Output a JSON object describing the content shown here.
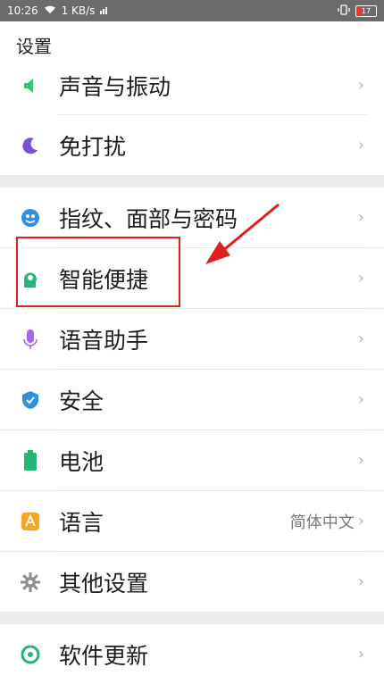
{
  "statusbar": {
    "time": "10:26",
    "speed": "1 KB/s",
    "battery": "17"
  },
  "header": {
    "title": "设置"
  },
  "items": [
    {
      "label": "声音与振动",
      "icon": "speaker-icon"
    },
    {
      "label": "免打扰",
      "icon": "moon-icon"
    },
    {
      "label": "指纹、面部与密码",
      "icon": "fingerprint-face-icon"
    },
    {
      "label": "智能便捷",
      "icon": "smart-head-icon"
    },
    {
      "label": "语音助手",
      "icon": "microphone-icon"
    },
    {
      "label": "安全",
      "icon": "shield-icon"
    },
    {
      "label": "电池",
      "icon": "battery-icon"
    },
    {
      "label": "语言",
      "value": "简体中文",
      "icon": "language-icon"
    },
    {
      "label": "其他设置",
      "icon": "gear-icon"
    },
    {
      "label": "软件更新",
      "icon": "update-icon"
    }
  ],
  "colors": {
    "highlight": "#e21d1d",
    "arrow": "#e21d1d"
  }
}
